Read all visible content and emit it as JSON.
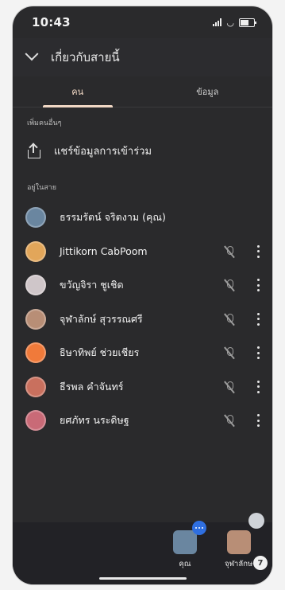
{
  "status": {
    "time": "10:43"
  },
  "header": {
    "title": "เกี่ยวกับสายนี้"
  },
  "tabs": [
    {
      "label": "คน",
      "active": true
    },
    {
      "label": "ข้อมูล",
      "active": false
    }
  ],
  "add_section_label": "เพิ่มคนอื่นๆ",
  "share": {
    "label": "แชร์ข้อมูลการเข้าร่วม",
    "icon": "share-icon"
  },
  "in_call_label": "อยู่ในสาย",
  "people": [
    {
      "name": "ธรรมรัตน์ จริตงาม (คุณ)",
      "muted": false,
      "has_menu": false,
      "avatar_color": "#6a86a0"
    },
    {
      "name": "Jittikorn CabPoom",
      "muted": true,
      "has_menu": true,
      "avatar_color": "#e2a65a"
    },
    {
      "name": "ขวัญจิรา ชูเชิด",
      "muted": true,
      "has_menu": true,
      "avatar_color": "#cfc6c9"
    },
    {
      "name": "จุฬาลักษ์ สุวรรณศรี",
      "muted": true,
      "has_menu": true,
      "avatar_color": "#b88e76"
    },
    {
      "name": "ธิษาทิพย์ ช่วยเชียร",
      "muted": true,
      "has_menu": true,
      "avatar_color": "#f07a3a"
    },
    {
      "name": "ธีรพล คำจันทร์",
      "muted": true,
      "has_menu": true,
      "avatar_color": "#c9705e"
    },
    {
      "name": "ยศภัทร นระดิษฐ",
      "muted": true,
      "has_menu": true,
      "avatar_color": "#c96a77"
    }
  ],
  "bottom": {
    "self_label": "คุณ",
    "other_label": "จุฬาลักษ",
    "count": "7"
  }
}
